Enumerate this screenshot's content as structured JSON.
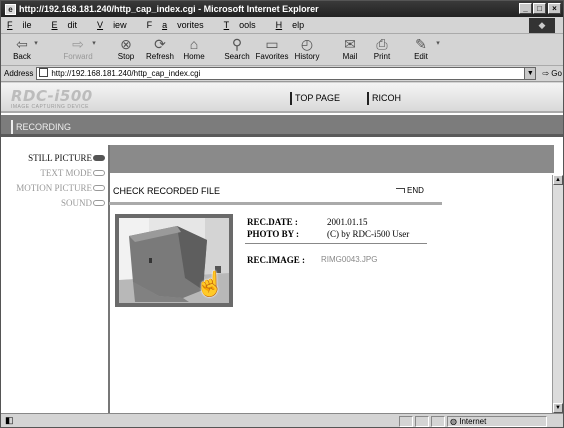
{
  "window": {
    "title": "http://192.168.181.240/http_cap_index.cgi - Microsoft Internet Explorer"
  },
  "menu": [
    {
      "u": "F",
      "rest": "ile"
    },
    {
      "u": "E",
      "rest": "dit"
    },
    {
      "u": "V",
      "rest": "iew"
    },
    {
      "pre": "F",
      "u": "a",
      "rest": "vorites"
    },
    {
      "u": "T",
      "rest": "ools"
    },
    {
      "u": "H",
      "rest": "elp"
    }
  ],
  "toolbar": {
    "back": "Back",
    "forward": "Forward",
    "stop": "Stop",
    "refresh": "Refresh",
    "home": "Home",
    "search": "Search",
    "favorites": "Favorites",
    "history": "History",
    "mail": "Mail",
    "print": "Print",
    "edit": "Edit"
  },
  "address": {
    "label": "Address",
    "url": "http://192.168.181.240/http_cap_index.cgi",
    "go": "Go"
  },
  "page": {
    "logo": "RDC-i500",
    "logo_sub": "IMAGE CAPTURING DEVICE",
    "nav_top": "TOP PAGE",
    "nav_ricoh": "RICOH",
    "section": "RECORDING",
    "sidebar": [
      {
        "label": "STILL PICTURE",
        "state": "active"
      },
      {
        "label": "TEXT MODE",
        "state": "inactive"
      },
      {
        "label": "MOTION PICTURE",
        "state": "inactive"
      },
      {
        "label": "SOUND",
        "state": "inactive"
      }
    ],
    "check_title": "CHECK RECORDED FILE",
    "end": "END",
    "rec_date_label": "REC.DATE :",
    "rec_date": "2001.01.15",
    "photo_by_label": "PHOTO BY :",
    "photo_by": "(C) by RDC-i500 User",
    "rec_image_label": "REC.IMAGE :",
    "rec_image": "RIMG0043.JPG"
  },
  "status": {
    "zone": "Internet"
  }
}
